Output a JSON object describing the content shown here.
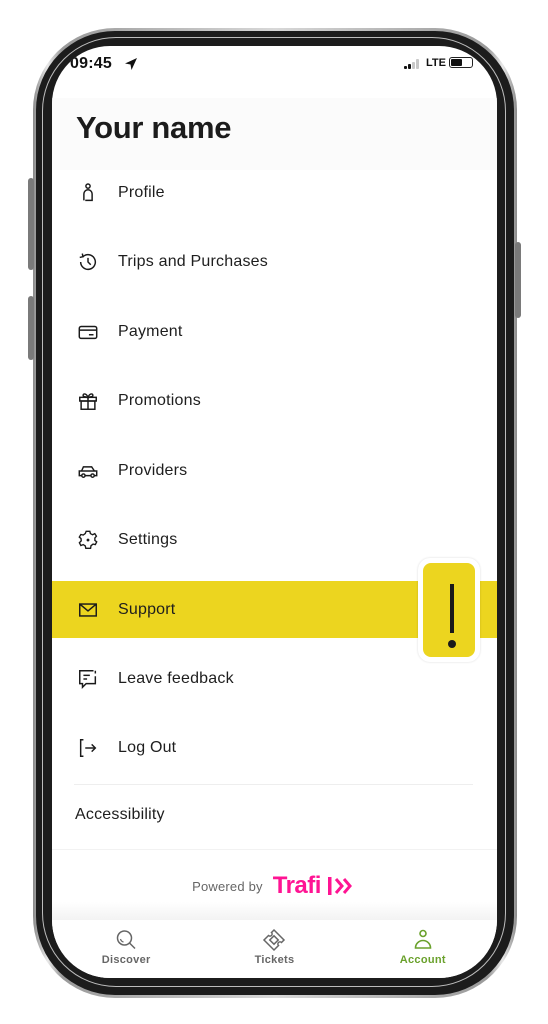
{
  "status_bar": {
    "time": "09:45",
    "network": "LTE",
    "location_icon": "location-arrow-icon",
    "signal_icon": "cellular-signal-icon",
    "battery_icon": "battery-icon"
  },
  "header": {
    "title": "Your name"
  },
  "menu": {
    "items": [
      {
        "label": "Profile",
        "icon": "person-icon"
      },
      {
        "label": "Trips and Purchases",
        "icon": "history-clock-icon"
      },
      {
        "label": "Payment",
        "icon": "credit-card-icon"
      },
      {
        "label": "Promotions",
        "icon": "gift-icon"
      },
      {
        "label": "Providers",
        "icon": "car-icon"
      },
      {
        "label": "Settings",
        "icon": "gear-icon"
      },
      {
        "label": "Support",
        "icon": "envelope-icon",
        "highlighted": true
      },
      {
        "label": "Leave feedback",
        "icon": "feedback-chat-icon"
      },
      {
        "label": "Log Out",
        "icon": "logout-icon"
      }
    ],
    "accessibility_label": "Accessibility"
  },
  "footer": {
    "powered_by": "Powered by",
    "brand": "Trafi",
    "brand_color": "#ff1493"
  },
  "tabbar": {
    "tabs": [
      {
        "label": "Discover",
        "icon": "search-icon",
        "active": false
      },
      {
        "label": "Tickets",
        "icon": "ticket-icon",
        "active": false
      },
      {
        "label": "Account",
        "icon": "person-icon",
        "active": true
      }
    ],
    "active_color": "#6aa12c"
  },
  "annotation": {
    "symbol": "!",
    "icon": "exclamation-icon",
    "highlight_color": "#ecd51f"
  }
}
